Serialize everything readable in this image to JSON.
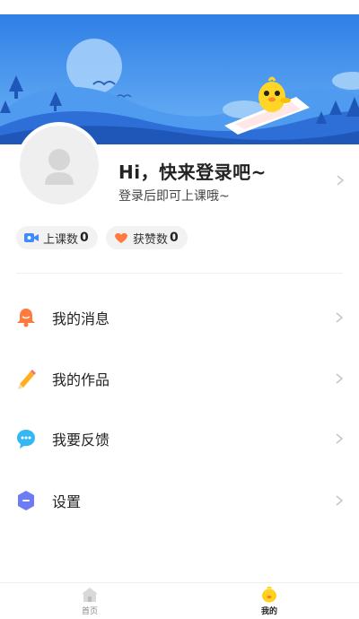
{
  "profile": {
    "greeting": "Hi，快来登录吧~",
    "subtext": "登录后即可上课哦~"
  },
  "stats": [
    {
      "label": "上课数",
      "value": "0",
      "icon": "video-camera-icon",
      "icon_color": "#3d8bfd"
    },
    {
      "label": "获赞数",
      "value": "0",
      "icon": "heart-icon",
      "icon_color": "#ff7a3d"
    }
  ],
  "menu": [
    {
      "label": "我的消息",
      "icon": "bell-icon",
      "icon_color": "#ff7a3d"
    },
    {
      "label": "我的作品",
      "icon": "pencil-icon",
      "icon_color": "#ffb020"
    },
    {
      "label": "我要反馈",
      "icon": "chat-bubble-icon",
      "icon_color": "#35b8f2"
    },
    {
      "label": "设置",
      "icon": "settings-hexagon-icon",
      "icon_color": "#6c7cf5"
    }
  ],
  "tabbar": {
    "items": [
      {
        "label": "首页",
        "icon": "home-icon",
        "active": false
      },
      {
        "label": "我的",
        "icon": "chick-icon",
        "active": true
      }
    ]
  },
  "colors": {
    "banner_sky": "#3d8ef0",
    "pill_bg": "#f2f2f2",
    "chevron": "#c8c8c8"
  }
}
